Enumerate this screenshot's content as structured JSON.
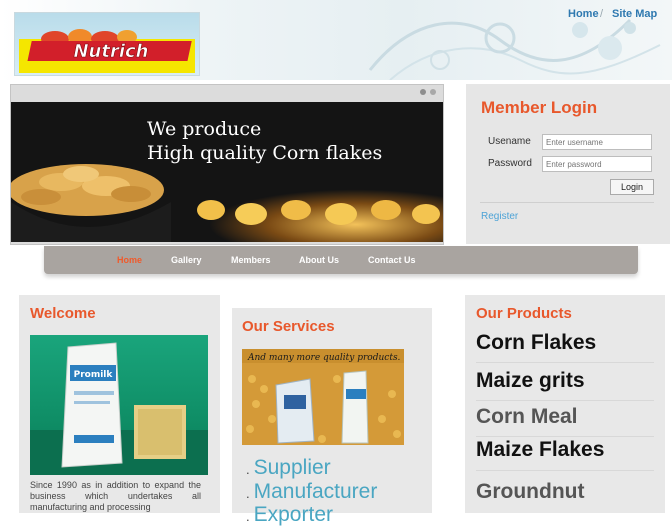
{
  "header": {
    "logo_text": "Nutrich",
    "top_links": [
      "Home",
      "Site Map"
    ]
  },
  "slider": {
    "headline_1": "We produce",
    "headline_2": "High quality Corn flakes",
    "active_dot": 0
  },
  "login": {
    "title": "Member Login",
    "username_label": "Usename",
    "username_placeholder": "Enter username",
    "password_label": "Password",
    "password_placeholder": "Enter password",
    "button_label": "Login",
    "register_label": "Register"
  },
  "nav": {
    "items": [
      "Home",
      "Gallery",
      "Members",
      "About Us",
      "Contact Us"
    ],
    "active": "Home"
  },
  "welcome": {
    "title": "Welcome",
    "bag_brand": "Promilk",
    "text": "Since 1990 as in addition to expand the business which undertakes all manufacturing and processing"
  },
  "services": {
    "title": "Our Services",
    "image_caption": "And many more quality products.",
    "items": [
      "Supplier",
      "Manufacturer",
      "Exporter"
    ]
  },
  "products": {
    "title": "Our Products",
    "items": [
      "Corn Flakes",
      "Maize grits",
      "Corn Meal",
      "Maize Flakes",
      "Groundnut"
    ]
  },
  "colors": {
    "accent_orange": "#e8582c",
    "link_blue": "#2f79b0",
    "service_blue": "#4aa6c2",
    "nav_bg": "#a9a4a0",
    "panel_grey": "#e8e8e8"
  }
}
